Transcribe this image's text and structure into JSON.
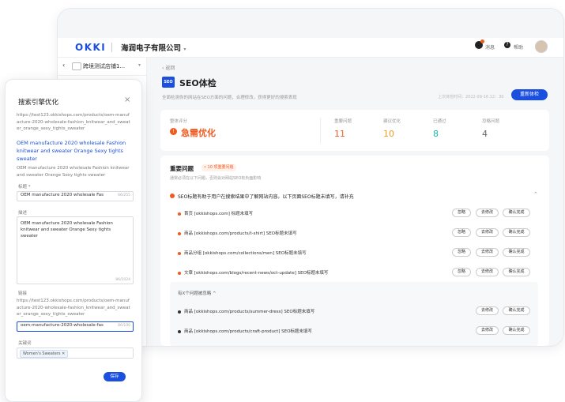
{
  "window_controls": {
    "colors": [
      "#3b6fe6",
      "#f7c21c",
      "#e81e26"
    ]
  },
  "topbar": {
    "logo": "OKKI",
    "company": "海润电子有限公司",
    "messages": "消息",
    "help": "帮助"
  },
  "sidebar": {
    "store_name": "跨境测试店铺1..."
  },
  "page": {
    "back": "返回",
    "seo_badge": "SEO",
    "title": "SEO体检",
    "subtitle": "全面检测你的网站在SEO方面的问题，合理修改，获得更好的搜索表现",
    "last_check": "上次体检时间：2022-09-16 12：30",
    "recheck_button": "重新体检"
  },
  "score": {
    "label": "整体评分",
    "status": "急需优化",
    "metrics": [
      {
        "label": "重要问题",
        "value": "11",
        "color": "#f05a1e"
      },
      {
        "label": "建议优化",
        "value": "10",
        "color": "#f39b1e"
      },
      {
        "label": "已通过",
        "value": "8",
        "color": "#16b9a8"
      },
      {
        "label": "忽略问题",
        "value": "4",
        "color": "#666666"
      }
    ]
  },
  "issues": {
    "title": "重要问题",
    "badge": "• 10 项重要问题",
    "desc": "通常必须在以下问题，否则会对网站SEO有负面影响",
    "group_title": "SEO标题有助于用户在搜索结果中了解网站内容。以下页面SEO标题未填写，请补充",
    "rows": [
      {
        "text": "首页 [okkishops.com] 标题未填写"
      },
      {
        "text": "商品 [okkishops.com/products/t-shirt] SEO标题未填写"
      },
      {
        "text": "商品分组 [okkishops.com/collections/men] SEO标题未填写"
      },
      {
        "text": "文章 [okkishops.com/blogs/recent-news/oct-update] SEO标题未填写"
      }
    ],
    "ignored_label": "有X个问题被忽略 ^",
    "ignored_rows": [
      {
        "text": "商品 [okkishops.com/products/summer-dress] SEO标题未填写"
      },
      {
        "text": "商品 [okkishops.com/products/craft-product] SEO标题未填写"
      }
    ],
    "btn_ignore": "忽略",
    "btn_fix": "去修改",
    "btn_confirm": "确认完成"
  },
  "seo_panel": {
    "title": "搜索引擎优化",
    "preview_url": "https://test123.okkishops.com/products/oem-manufacture-2020-wholesale-fashion_knitwear_and_sweater_orange_sexy_tights_sweater",
    "preview_title": "OEM manufacture 2020 wholesale Fashion knitwear and sweater Orange Sexy tights sweater",
    "preview_desc": "OEM manufacture 2020 wholesale Fashion knitwear and sweater Orange Sexy tights sweater",
    "title_label": "标题 *",
    "title_value": "OEM manufacture 2020 wholesale  Fas",
    "title_count": "66/255",
    "desc_label": "描述",
    "desc_value": "OEM manufacture 2020 wholesale Fashion knitwear and sweater Orange Sexy tights sweater",
    "desc_count": "86/1024",
    "link_label": "链接",
    "link_preview": "https://test123.okkishops.com/products/oem-manufacture-2020-wholesale-fashion_knitwear_and_sweater_orange_sexy_tights_sweater",
    "link_value": "oem-manufacture-2020-wholesale-fas",
    "link_count": "86/100",
    "keywords_label": "关键词",
    "keyword_tag": "Women's Sweaters",
    "save_button": "保存"
  }
}
